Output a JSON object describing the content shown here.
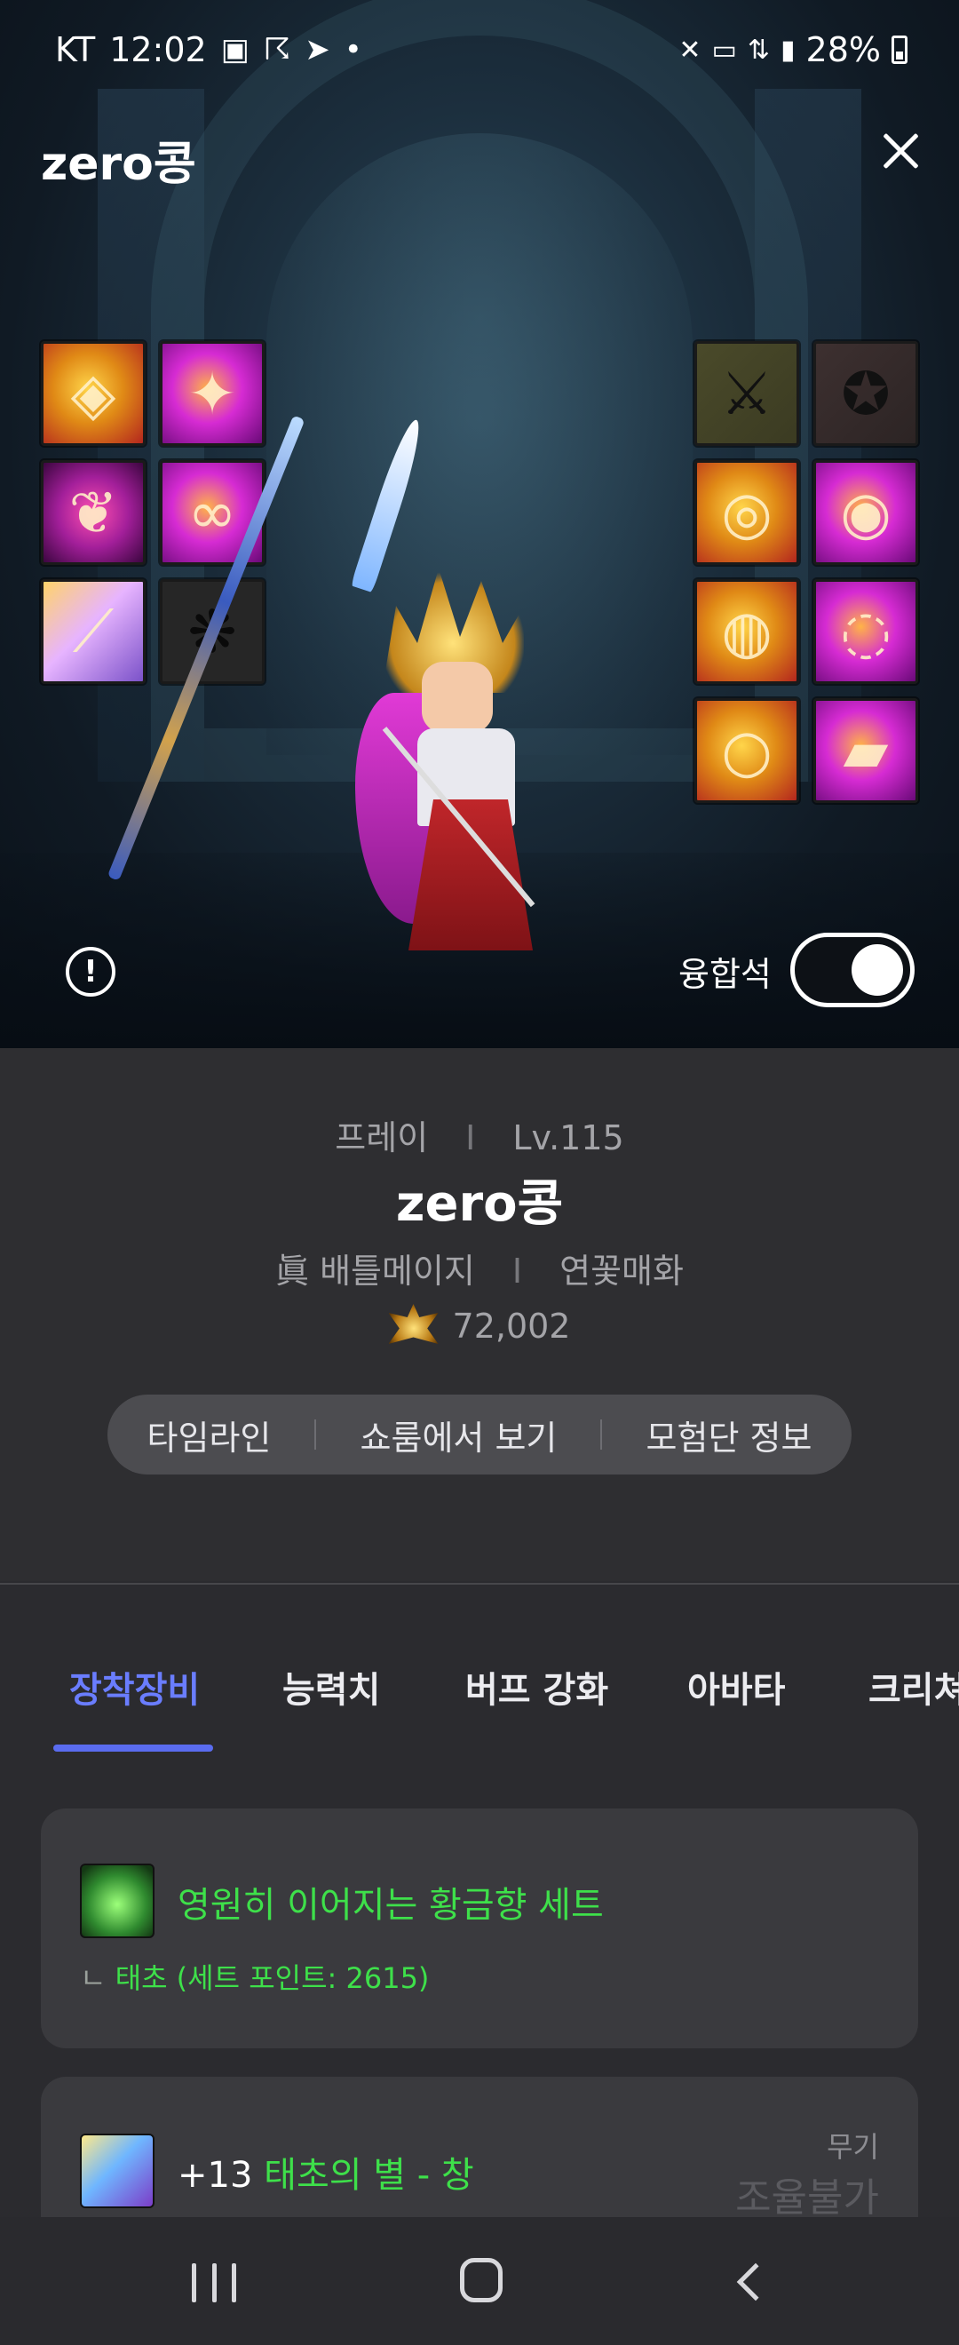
{
  "status_bar": {
    "carrier": "KT",
    "time": "12:02",
    "battery": "28%"
  },
  "header": {
    "title": "zero콩"
  },
  "equipment_slots": {
    "left": [
      "gold-emblem-icon",
      "armor-icon",
      "cape-icon",
      "chain-icon",
      "weapon-glow-icon",
      "paw-icon"
    ],
    "right": [
      "sword-icon",
      "medal-icon",
      "ring-icon",
      "ring-icon",
      "ring-icon",
      "ring-icon",
      "ring-icon",
      "bar-icon"
    ]
  },
  "fusion": {
    "label": "융합석",
    "enabled": true
  },
  "profile": {
    "world": "프레이",
    "level": "Lv.115",
    "name": "zero콩",
    "class": "眞 배틀메이지",
    "guild": "연꽃매화",
    "power": "72,002"
  },
  "actions": {
    "timeline": "타임라인",
    "showroom": "쇼룸에서 보기",
    "adventure": "모험단 정보"
  },
  "tabs": [
    "장착장비",
    "능력치",
    "버프 강화",
    "아바타",
    "크리쳐"
  ],
  "set_card": {
    "title": "영원히 이어지는 황금향 세트",
    "prefix": "ㄴ ",
    "subtitle": "태초 (세트 포인트: 2615)"
  },
  "weapon_card": {
    "enhance": "+13",
    "name": "태초의 별 - 창",
    "type": "무기",
    "tune": "조율불가"
  },
  "colors": {
    "accent": "#5a6cf0",
    "set_green": "#3ee04a"
  }
}
